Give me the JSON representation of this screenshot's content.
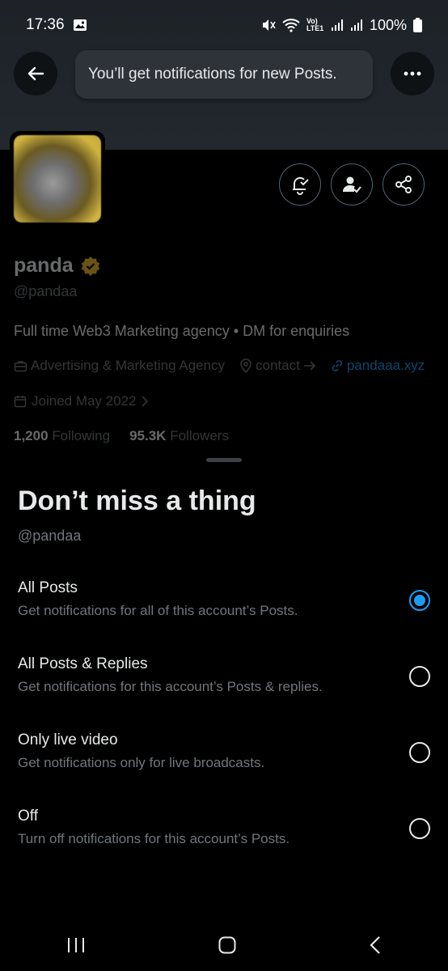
{
  "status_bar": {
    "time": "17:36",
    "battery": "100%",
    "network": "Vo) LTE1"
  },
  "toast": {
    "text": "You’ll get notifications for new Posts."
  },
  "profile": {
    "name": "panda",
    "handle": "@pandaa",
    "bio": "Full time Web3 Marketing agency • DM for enquiries",
    "category": "Advertising & Marketing Agency",
    "contact": "contact",
    "link": "pandaaa.xyz",
    "joined": "Joined May 2022",
    "following_count": "1,200",
    "following_label": "Following",
    "followers_count": "95.3K",
    "followers_label": "Followers"
  },
  "sheet": {
    "title": "Don’t miss a thing",
    "handle": "@pandaa",
    "options": [
      {
        "title": "All Posts",
        "desc": "Get notifications for all of this account’s Posts.",
        "selected": true
      },
      {
        "title": "All Posts & Replies",
        "desc": "Get notifications for this account’s Posts & replies.",
        "selected": false
      },
      {
        "title": "Only live video",
        "desc": "Get notifications only for live broadcasts.",
        "selected": false
      },
      {
        "title": "Off",
        "desc": "Turn off notifications for this account’s Posts.",
        "selected": false
      }
    ]
  },
  "colors": {
    "accent": "#1d9bf0",
    "verified": "#c9a227",
    "background": "#000000"
  }
}
